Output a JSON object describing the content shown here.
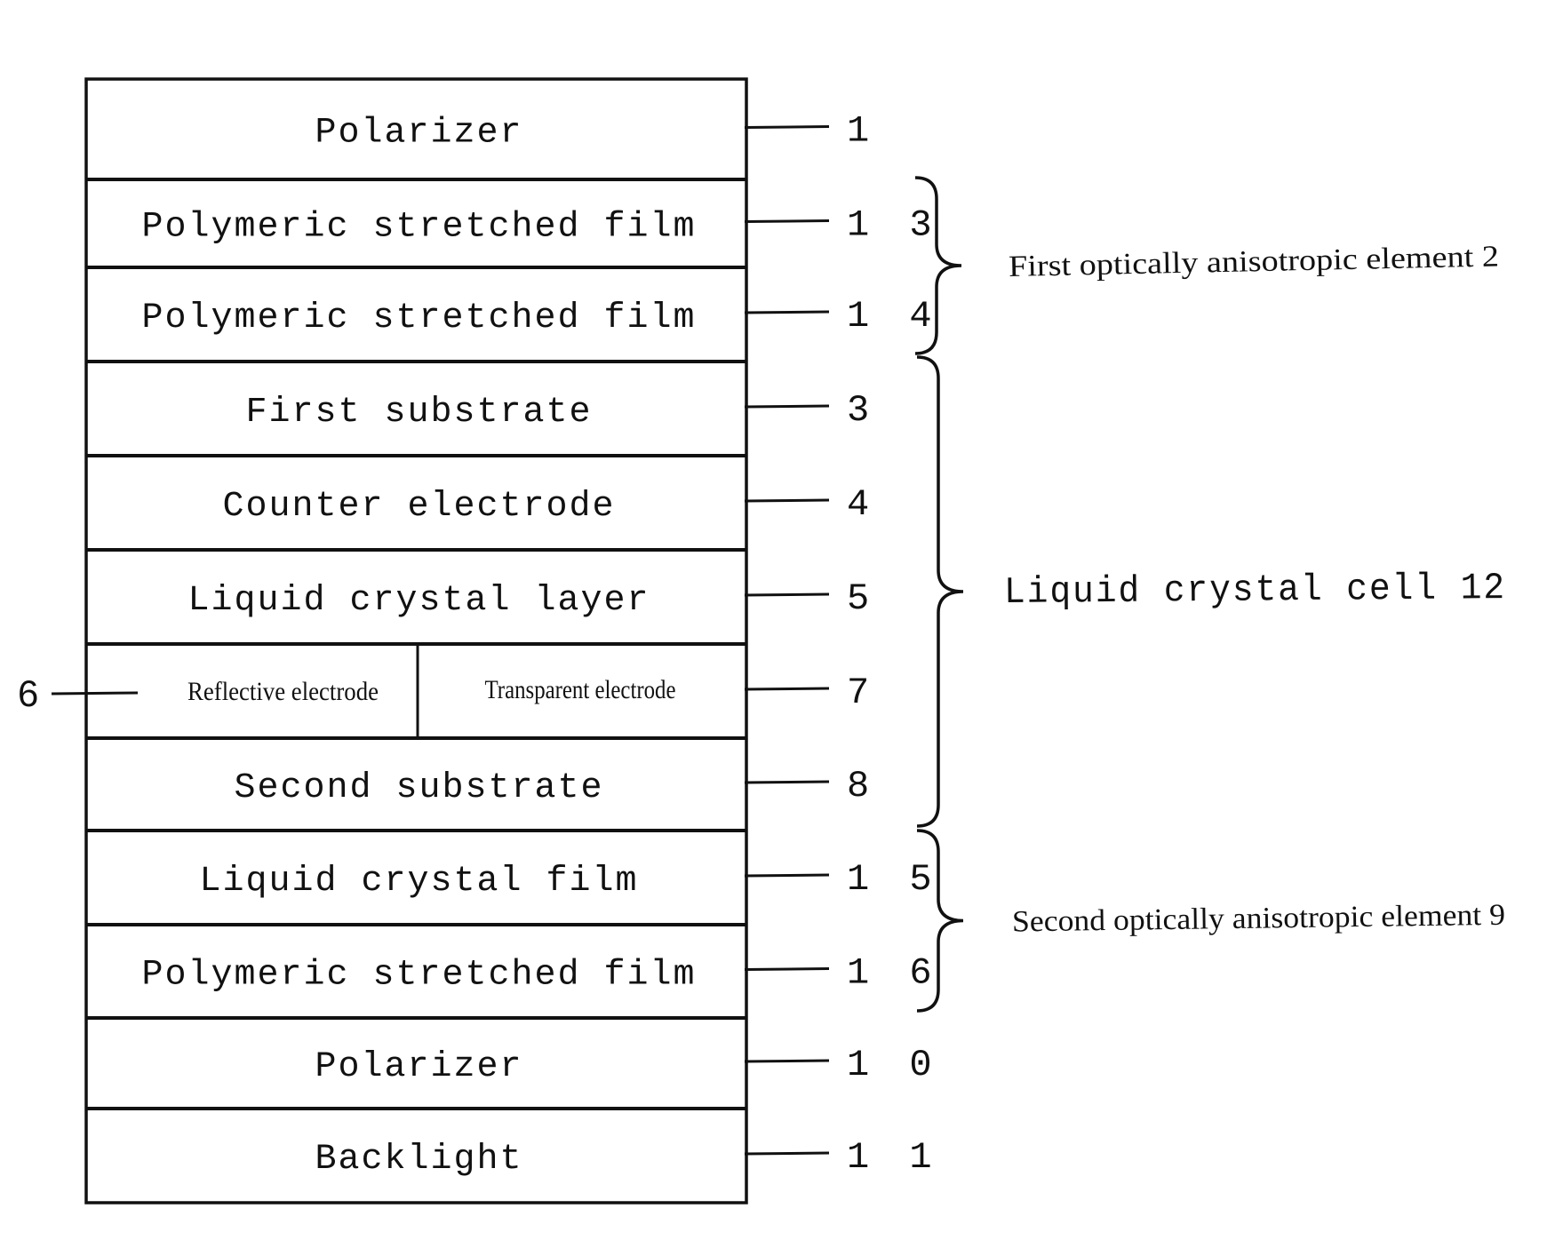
{
  "figure": {
    "layers": [
      {
        "label": "Polarizer",
        "ref": "1"
      },
      {
        "label": "Polymeric stretched film",
        "ref": "1 3"
      },
      {
        "label": "Polymeric stretched film",
        "ref": "1 4"
      },
      {
        "label": "First substrate",
        "ref": "3"
      },
      {
        "label": "Counter electrode",
        "ref": "4"
      },
      {
        "label": "Liquid crystal layer",
        "ref": "5"
      },
      {
        "label": "",
        "ref": "7",
        "split": {
          "left": "Reflective electrode",
          "right": "Transparent electrode",
          "left_ref": "6"
        }
      },
      {
        "label": "Second substrate",
        "ref": "8"
      },
      {
        "label": "Liquid crystal film",
        "ref": "1 5"
      },
      {
        "label": "Polymeric stretched film",
        "ref": "1 6"
      },
      {
        "label": "Polarizer",
        "ref": "1 0"
      },
      {
        "label": "Backlight",
        "ref": "1 1"
      }
    ],
    "groups": [
      {
        "label": "First optically anisotropic element 2",
        "from_layer": 1,
        "to_layer": 2
      },
      {
        "label": "Liquid crystal cell 12",
        "from_layer": 3,
        "to_layer": 7
      },
      {
        "label": "Second optically anisotropic element 9",
        "from_layer": 8,
        "to_layer": 9
      }
    ]
  }
}
